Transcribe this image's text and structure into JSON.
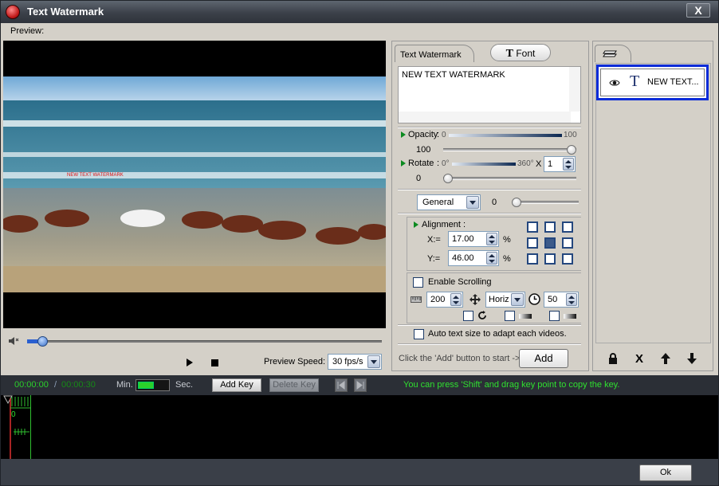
{
  "window": {
    "title": "Text Watermark",
    "close_label": "X"
  },
  "preview": {
    "label": "Preview:"
  },
  "player": {
    "speed_label": "Preview Speed:",
    "speed_value": "30 fps/s",
    "seek_position": 0.03
  },
  "tabs": {
    "text_watermark": "Text Watermark",
    "font": "Font",
    "font_icon_glyph": "T"
  },
  "text_input": {
    "value": "NEW TEXT WATERMARK"
  },
  "opacity": {
    "label": "Opacity",
    "min": "0",
    "max": "100",
    "value": "100",
    "fraction": 1.0
  },
  "rotate": {
    "label": "Rotate",
    "min": "0°",
    "max": "360°",
    "value": "0",
    "multiplier_prefix": "X",
    "multiplier": "1",
    "fraction": 0.0
  },
  "style": {
    "selected": "General",
    "value": "0"
  },
  "alignment": {
    "label": "Alignment :",
    "x_label": "X:=",
    "x_value": "17.00",
    "y_label": "Y:=",
    "y_value": "46.00",
    "unit": "%"
  },
  "scrolling": {
    "label": "Enable Scrolling",
    "speed": "200",
    "direction": "Horiz",
    "duration": "50"
  },
  "auto_size": {
    "label": "Auto text size to adapt each videos."
  },
  "add": {
    "hint": "Click the 'Add' button to start ->",
    "label": "Add"
  },
  "layers": {
    "items": [
      {
        "label": "NEW TEXT..."
      }
    ]
  },
  "layer_buttons": {
    "delete": "X"
  },
  "timeline": {
    "current": "00:00:00",
    "separator": "/",
    "total": "00:00:30",
    "min_label": "Min.",
    "sec_label": "Sec.",
    "add_key": "Add Key",
    "delete_key": "Delete Key",
    "hint": "You can press 'Shift' and drag key point to copy the key.",
    "ruler_zero": "0"
  },
  "footer": {
    "ok": "Ok"
  },
  "colors": {
    "accent_green": "#2fe02f",
    "selection_blue": "#0a2bd8"
  }
}
